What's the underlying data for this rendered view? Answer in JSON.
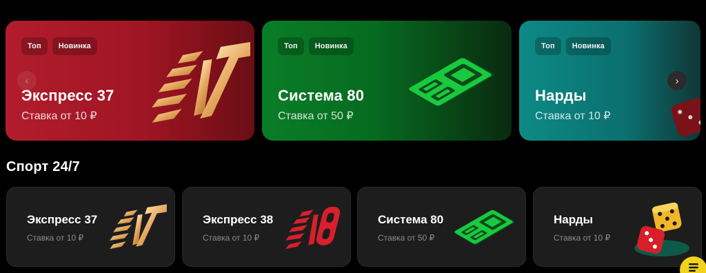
{
  "banners": [
    {
      "tags": [
        "Топ",
        "Новинка"
      ],
      "title": "Экспресс 37",
      "subtitle": "Ставка от 10 ₽",
      "art": "express-37-logo"
    },
    {
      "tags": [
        "Топ",
        "Новинка"
      ],
      "title": "Система 80",
      "subtitle": "Ставка от 50 ₽",
      "art": "sistema-80-logo"
    },
    {
      "tags": [
        "Топ",
        "Новинка"
      ],
      "title": "Нарды",
      "subtitle": "Ставка от 10 ₽",
      "art": "dice-icon"
    }
  ],
  "carousel_nav": {
    "prev_icon": "chevron-left-icon",
    "next_icon": "chevron-right-icon",
    "prev_glyph": "‹",
    "next_glyph": "›"
  },
  "section": {
    "title": "Спорт 24/7"
  },
  "cards": [
    {
      "title": "Экспресс 37",
      "subtitle": "Ставка от 10 ₽",
      "art": "express-37-logo"
    },
    {
      "title": "Экспресс 38",
      "subtitle": "Ставка от 10 ₽",
      "art": "express-38-logo"
    },
    {
      "title": "Система 80",
      "subtitle": "Ставка от 50 ₽",
      "art": "sistema-80-logo"
    },
    {
      "title": "Нарды",
      "subtitle": "Ставка от 10 ₽",
      "art": "dice-icon"
    }
  ],
  "colors": {
    "red_banner": "#b11d2c",
    "green_banner": "#0a7d27",
    "teal_banner": "#0d8a86",
    "card_bg": "#1d1d1d",
    "gold": "#e9b267",
    "accent_red": "#d81f2c",
    "accent_green": "#17c23d",
    "fab_yellow": "#f2d31b"
  },
  "fab": {
    "icon": "chat-menu-icon"
  }
}
